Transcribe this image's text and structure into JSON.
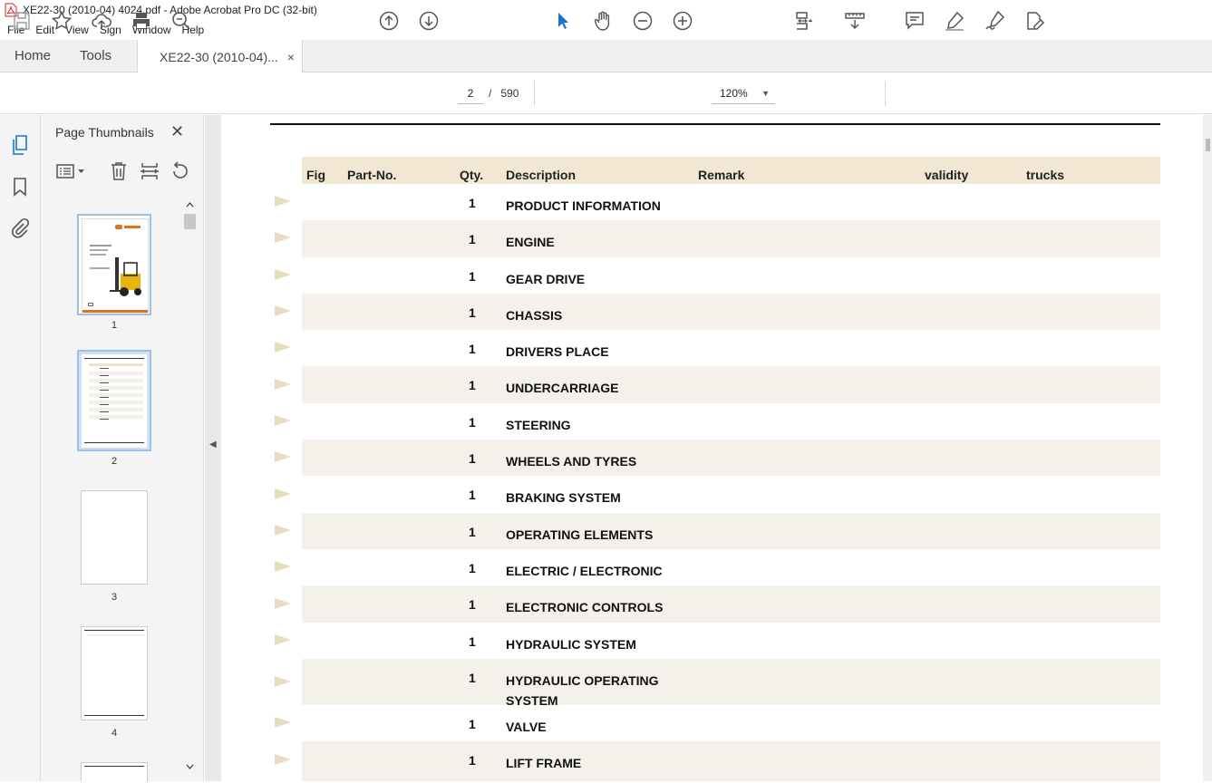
{
  "window": {
    "title": "XE22-30 (2010-04) 4024.pdf - Adobe Acrobat Pro DC (32-bit)"
  },
  "menu": [
    "File",
    "Edit",
    "View",
    "Sign",
    "Window",
    "Help"
  ],
  "tabs": {
    "home": "Home",
    "tools": "Tools",
    "document": "XE22-30 (2010-04)...",
    "close": "×"
  },
  "toolbar": {
    "current_page": "2",
    "page_separator": "/",
    "total_pages": "590",
    "zoom": "120%"
  },
  "panel": {
    "title": "Page Thumbnails",
    "close": "✕",
    "thumbnails": [
      {
        "number": "1",
        "selected": false
      },
      {
        "number": "2",
        "selected": true
      },
      {
        "number": "3",
        "selected": false
      },
      {
        "number": "4",
        "selected": false
      }
    ]
  },
  "table": {
    "headers": {
      "fig": "Fig",
      "part_no": "Part-No.",
      "qty": "Qty.",
      "description": "Description",
      "remark": "Remark",
      "validity": "validity",
      "trucks": "trucks"
    },
    "rows": [
      {
        "qty": "1",
        "description": "PRODUCT INFORMATION"
      },
      {
        "qty": "1",
        "description": "ENGINE"
      },
      {
        "qty": "1",
        "description": "GEAR DRIVE"
      },
      {
        "qty": "1",
        "description": "CHASSIS"
      },
      {
        "qty": "1",
        "description": "DRIVERS PLACE"
      },
      {
        "qty": "1",
        "description": "UNDERCARRIAGE"
      },
      {
        "qty": "1",
        "description": "STEERING"
      },
      {
        "qty": "1",
        "description": "WHEELS AND TYRES"
      },
      {
        "qty": "1",
        "description": "BRAKING SYSTEM"
      },
      {
        "qty": "1",
        "description": "OPERATING ELEMENTS"
      },
      {
        "qty": "1",
        "description": "ELECTRIC / ELECTRONIC"
      },
      {
        "qty": "1",
        "description": "ELECTRONIC CONTROLS"
      },
      {
        "qty": "1",
        "description": "HYDRAULIC SYSTEM"
      },
      {
        "qty": "1",
        "description": "HYDRAULIC OPERATING",
        "description_line2": "SYSTEM"
      },
      {
        "qty": "1",
        "description": "VALVE"
      },
      {
        "qty": "1",
        "description": "LIFT FRAME"
      }
    ]
  },
  "colors": {
    "header_band": "#f1e7d2",
    "row_shade": "#f3f1ea",
    "arrow": "#e8dcc0",
    "accent_blue": "#1a73c9",
    "pdf_red": "#d4261e"
  }
}
